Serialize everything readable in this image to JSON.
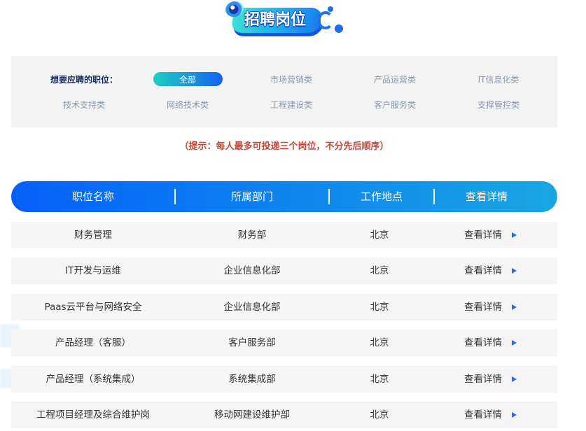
{
  "banner": {
    "title": "招聘岗位"
  },
  "filter": {
    "label": "想要应聘的职位：",
    "categories": [
      "全部",
      "市场营销类",
      "产品运营类",
      "IT信息化类",
      "技术支持类",
      "网络技术类",
      "工程建设类",
      "客户服务类",
      "支撑管控类"
    ],
    "selected_index": 0
  },
  "hint": "（提示：每人最多可投递三个岗位，不分先后顺序）",
  "table": {
    "headers": [
      "职位名称",
      "所属部门",
      "工作地点",
      "查看详情"
    ],
    "rows": [
      {
        "title": "财务管理",
        "department": "财务部",
        "location": "北京",
        "action": "查看详情"
      },
      {
        "title": "IT开发与运维",
        "department": "企业信息化部",
        "location": "北京",
        "action": "查看详情"
      },
      {
        "title": "Paas云平台与网络安全",
        "department": "企业信息化部",
        "location": "北京",
        "action": "查看详情"
      },
      {
        "title": "产品经理（客服）",
        "department": "客户服务部",
        "location": "北京",
        "action": "查看详情"
      },
      {
        "title": "产品经理（系统集成）",
        "department": "系统集成部",
        "location": "北京",
        "action": "查看详情"
      },
      {
        "title": "工程项目经理及综合维护岗",
        "department": "移动网建设维护部",
        "location": "北京",
        "action": "查看详情"
      }
    ]
  },
  "icons": {
    "banner_eye": "eye-icon",
    "row_action": "arrow-right-icon"
  },
  "colors": {
    "header_gradient_start": "#0560fb",
    "header_gradient_end": "#18a7e3",
    "active_pill_start": "#1fd0c0",
    "active_pill_end": "#1462f2",
    "hint_text": "#c4473a",
    "detail_arrow": "#1a6ff0",
    "category_text": "#8a97ab",
    "filter_label": "#1d2c5e"
  }
}
